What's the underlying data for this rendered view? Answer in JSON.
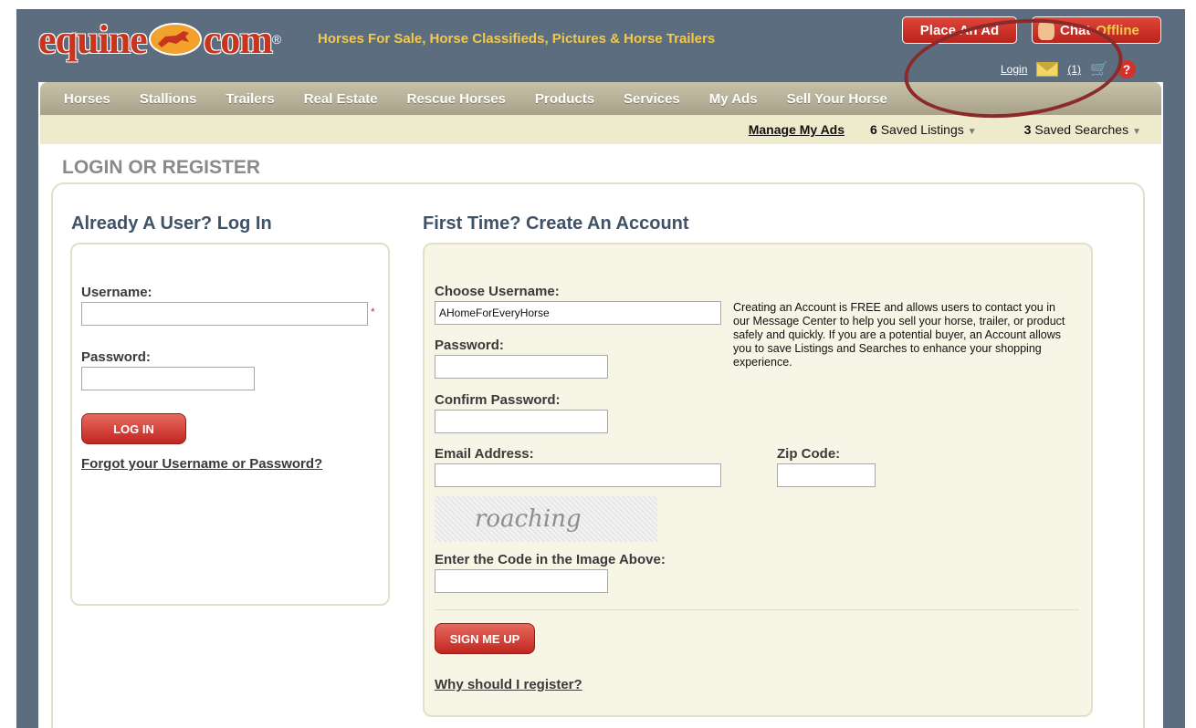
{
  "header": {
    "logo_text": "equine",
    "logo_text_2": "com",
    "logo_reg": "®",
    "tagline": "Horses For Sale, Horse Classifieds, Pictures & Horse Trailers",
    "place_ad": "Place An Ad",
    "chat_label": "Chat",
    "chat_status": "Offline",
    "login_link": "Login",
    "mail_count": "(1)",
    "help": "?"
  },
  "nav": {
    "items": [
      {
        "label": "Horses"
      },
      {
        "label": "Stallions"
      },
      {
        "label": "Trailers"
      },
      {
        "label": "Real Estate"
      },
      {
        "label": "Rescue Horses"
      },
      {
        "label": "Products"
      },
      {
        "label": "Services"
      },
      {
        "label": "My Ads"
      },
      {
        "label": "Sell Your Horse"
      }
    ]
  },
  "subbar": {
    "manage": "Manage My Ads",
    "saved_listings_count": "6",
    "saved_listings_label": " Saved Listings",
    "saved_searches_count": "3",
    "saved_searches_label": " Saved Searches"
  },
  "page_title": "LOGIN OR REGISTER",
  "login": {
    "heading": "Already A User? Log In",
    "username_label": "Username:",
    "username_value": "",
    "required_mark": "*",
    "password_label": "Password:",
    "password_value": "",
    "button": "LOG IN",
    "forgot": "Forgot your Username or Password?"
  },
  "register": {
    "heading": "First Time? Create An Account",
    "username_label": "Choose Username:",
    "username_value": "AHomeForEveryHorse",
    "password_label": "Password:",
    "confirm_label": "Confirm Password:",
    "email_label": "Email Address:",
    "zip_label": "Zip Code:",
    "captcha_text": "roaching",
    "captcha_label": "Enter the Code in the Image Above:",
    "info": "Creating an Account is FREE and allows users to contact you in our Message Center to help you sell your horse, trailer, or product safely and quickly. If you are a potential buyer, an Account allows you to save Listings and Searches to enhance your shopping experience.",
    "button": "SIGN ME UP",
    "why": "Why should I register?"
  },
  "colors": {
    "brand_red": "#c8351f",
    "header_bg": "#5c6d80",
    "tagline": "#f2c94c",
    "heading": "#3f5267"
  }
}
